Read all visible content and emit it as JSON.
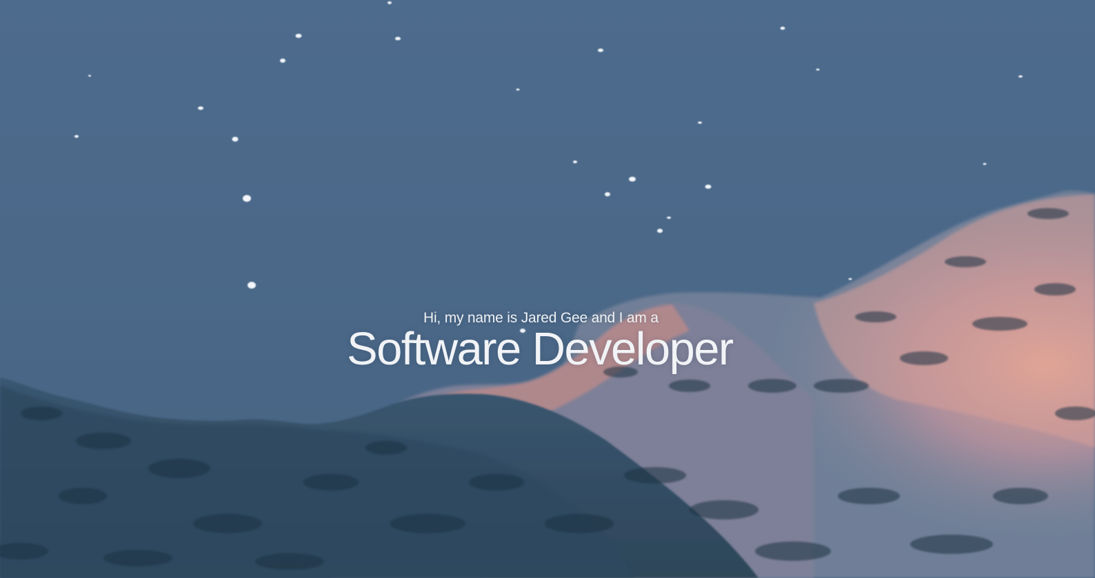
{
  "hero": {
    "greeting": "Hi, my name is Jared Gee and I am a",
    "role": "Software Developer"
  }
}
